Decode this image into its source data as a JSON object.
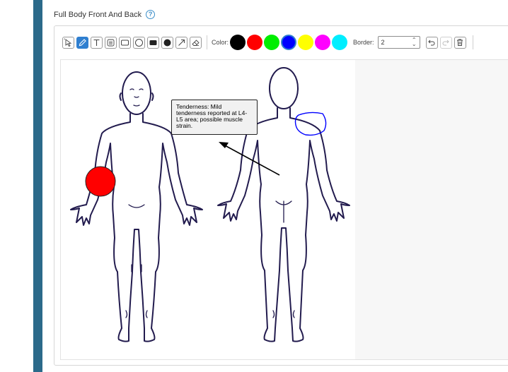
{
  "section": {
    "title": "Full Body Front And Back",
    "help_icon": "question-circle-icon"
  },
  "toolbar": {
    "tools": [
      {
        "name": "select",
        "icon": "pointer-select-icon",
        "active": false
      },
      {
        "name": "pen",
        "icon": "pencil-icon",
        "active": true
      },
      {
        "name": "text",
        "icon": "text-T-icon",
        "active": false
      },
      {
        "name": "note",
        "icon": "note-icon",
        "active": false
      },
      {
        "name": "rectangle",
        "icon": "rectangle-icon",
        "active": false
      },
      {
        "name": "circle",
        "icon": "circle-icon",
        "active": false
      },
      {
        "name": "filled-rectangle",
        "icon": "filled-rectangle-icon",
        "active": false
      },
      {
        "name": "filled-circle",
        "icon": "filled-circle-icon",
        "active": false
      },
      {
        "name": "arrow",
        "icon": "arrow-icon",
        "active": false
      },
      {
        "name": "eraser",
        "icon": "eraser-icon",
        "active": false
      }
    ],
    "color_label": "Color:",
    "colors": [
      "#000000",
      "#ff0000",
      "#00ee00",
      "#0000ff",
      "#ffff00",
      "#ff00ff",
      "#00eeff"
    ],
    "selected_color": "#0000ff",
    "border_label": "Border:",
    "border_value": "2",
    "history": [
      {
        "name": "undo",
        "icon": "undo-icon",
        "enabled": true
      },
      {
        "name": "redo",
        "icon": "redo-icon",
        "enabled": false
      },
      {
        "name": "clear",
        "icon": "trash-icon",
        "enabled": true
      }
    ]
  },
  "annotation": {
    "tooltip_text": "Tenderness: Mild tenderness reported at L4-L5 area; possible muscle strain."
  }
}
